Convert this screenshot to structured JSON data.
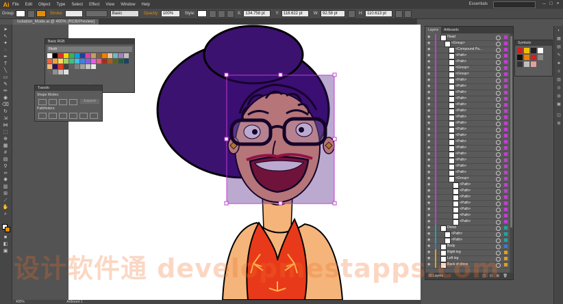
{
  "app": {
    "logo": "Ai"
  },
  "menu": [
    "File",
    "Edit",
    "Object",
    "Type",
    "Select",
    "Effect",
    "View",
    "Window",
    "Help"
  ],
  "workspace": {
    "label": "Essentials"
  },
  "control_bar": {
    "selection": "Group",
    "stroke_label": "Stroke:",
    "stroke_style": "Basic",
    "opacity_label": "Opacity:",
    "opacity_value": "100%",
    "style_label": "Style:",
    "x_value": "134.758 pt",
    "y_value": "118.622 pt",
    "w_value": "92.58 pt",
    "h_value": "110.613 pt",
    "fill_color": "#ffffff",
    "stroke_color": "#e58d00"
  },
  "doc_tab": {
    "label": "Isolation_Mode.ai @ 400% (RGB/Preview)"
  },
  "status_bar": {
    "zoom": "400%",
    "artboard": "Artboard 1"
  },
  "swatches_panel": {
    "title": "Basic RGB",
    "subtitle": "Flesh"
  },
  "pathfinder_panel": {
    "tab": "Transfo",
    "shape_modes": "Shape Modes:",
    "pathfinders": "Pathfinders:",
    "expand": "Expand"
  },
  "layers_panel": {
    "tabs": [
      "Layers",
      "Artboards"
    ],
    "footer": "10 Layers",
    "rows": [
      {
        "name": "Head",
        "indent": 0,
        "color": "#c03fd0"
      },
      {
        "name": "<Group>",
        "indent": 1,
        "color": "#c03fd0"
      },
      {
        "name": "<Compound Pa...",
        "indent": 2,
        "color": "#c03fd0"
      },
      {
        "name": "<Path>",
        "indent": 2,
        "color": "#c03fd0"
      },
      {
        "name": "<Path>",
        "indent": 2,
        "color": "#c03fd0"
      },
      {
        "name": "<Group>",
        "indent": 2,
        "color": "#c03fd0"
      },
      {
        "name": "<Group>",
        "indent": 2,
        "color": "#c03fd0"
      },
      {
        "name": "<Path>",
        "indent": 2,
        "color": "#c03fd0"
      },
      {
        "name": "<Path>",
        "indent": 2,
        "color": "#c03fd0"
      },
      {
        "name": "<Path>",
        "indent": 2,
        "color": "#c03fd0"
      },
      {
        "name": "<Path>",
        "indent": 2,
        "color": "#c03fd0"
      },
      {
        "name": "<Path>",
        "indent": 2,
        "color": "#c03fd0"
      },
      {
        "name": "<Path>",
        "indent": 2,
        "color": "#c03fd0"
      },
      {
        "name": "<Path>",
        "indent": 2,
        "color": "#c03fd0"
      },
      {
        "name": "<Path>",
        "indent": 2,
        "color": "#c03fd0"
      },
      {
        "name": "<Path>",
        "indent": 2,
        "color": "#c03fd0"
      },
      {
        "name": "<Path>",
        "indent": 2,
        "color": "#c03fd0"
      },
      {
        "name": "<Path>",
        "indent": 2,
        "color": "#c03fd0"
      },
      {
        "name": "<Path>",
        "indent": 2,
        "color": "#c03fd0"
      },
      {
        "name": "<Path>",
        "indent": 2,
        "color": "#c03fd0"
      },
      {
        "name": "<Path>",
        "indent": 2,
        "color": "#c03fd0"
      },
      {
        "name": "<Path>",
        "indent": 2,
        "color": "#c03fd0"
      },
      {
        "name": "<Path>",
        "indent": 2,
        "color": "#c03fd0"
      },
      {
        "name": "<Group>",
        "indent": 2,
        "color": "#c03fd0"
      },
      {
        "name": "<Path>",
        "indent": 3,
        "color": "#c03fd0"
      },
      {
        "name": "<Path>",
        "indent": 3,
        "color": "#c03fd0"
      },
      {
        "name": "<Path>",
        "indent": 3,
        "color": "#c03fd0"
      },
      {
        "name": "<Path>",
        "indent": 3,
        "color": "#c03fd0"
      },
      {
        "name": "<Path>",
        "indent": 3,
        "color": "#c03fd0"
      },
      {
        "name": "<Path>",
        "indent": 3,
        "color": "#c03fd0"
      },
      {
        "name": "<Path>",
        "indent": 3,
        "color": "#c03fd0"
      },
      {
        "name": "Dress",
        "indent": 0,
        "color": "#1fa5a5"
      },
      {
        "name": "<Path>",
        "indent": 1,
        "color": "#1fa5a5"
      },
      {
        "name": "<Path>",
        "indent": 1,
        "color": "#1fa5a5"
      },
      {
        "name": "Body",
        "indent": 0,
        "color": "#2d7de0"
      },
      {
        "name": "Right leg",
        "indent": 0,
        "color": "#e0a020"
      },
      {
        "name": "Left leg",
        "indent": 0,
        "color": "#e0a020"
      },
      {
        "name": "Back of dress",
        "indent": 0,
        "color": "#e0a020"
      }
    ]
  },
  "symbols_panel": {
    "title": "Symbols"
  },
  "watermark": "设计软件通 developmestapps.com",
  "colors": {
    "hat": "#2e0e5e",
    "skin": "#f7b77a",
    "dress": "#e83a1a",
    "lips": "#c21a2a"
  }
}
